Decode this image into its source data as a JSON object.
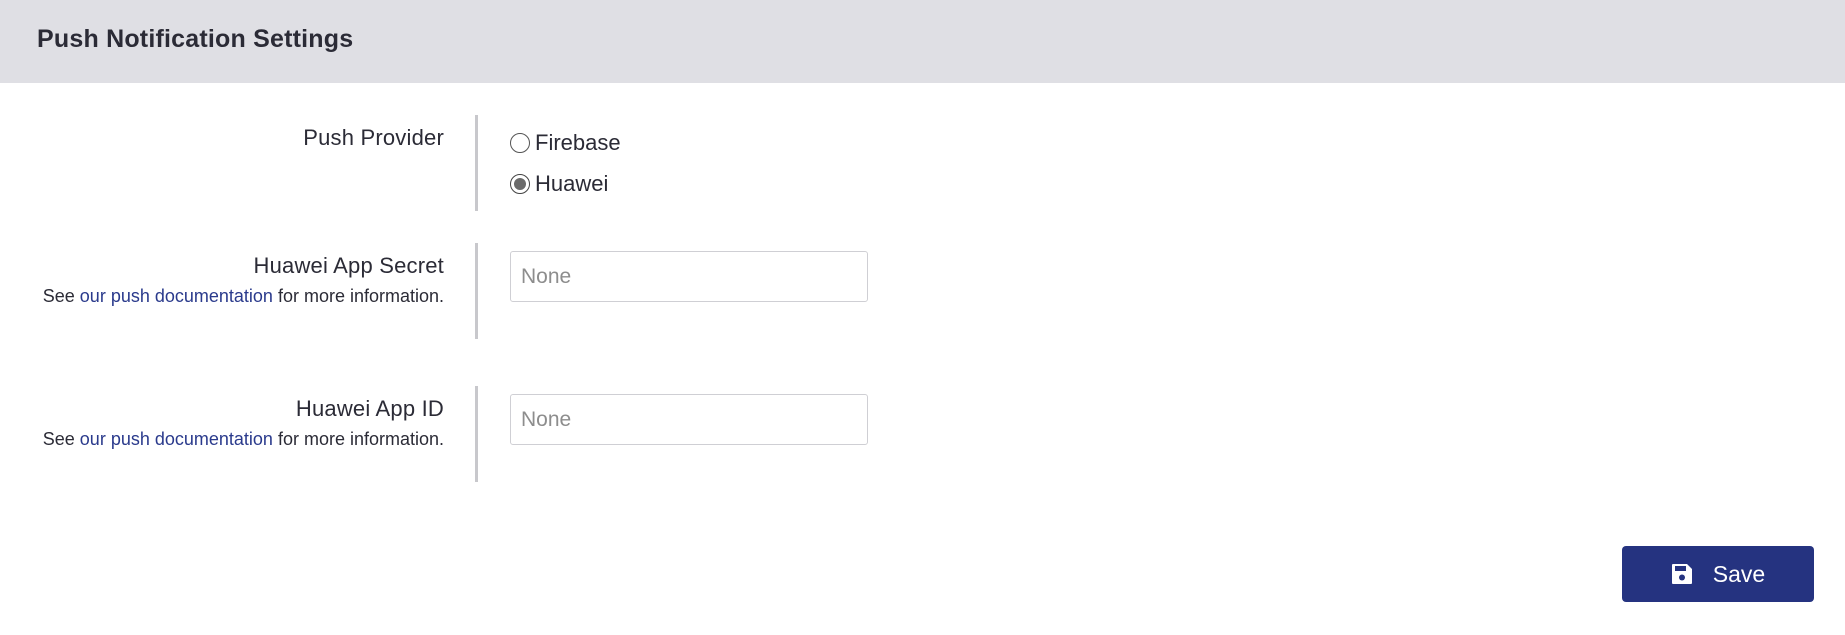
{
  "header": {
    "title": "Push Notification Settings"
  },
  "push_provider": {
    "label": "Push Provider",
    "options": [
      {
        "label": "Firebase",
        "selected": false
      },
      {
        "label": "Huawei",
        "selected": true
      }
    ]
  },
  "app_secret": {
    "label": "Huawei App Secret",
    "help_prefix": "See ",
    "help_link": "our push documentation",
    "help_suffix": " for more information.",
    "placeholder": "None",
    "value": ""
  },
  "app_id": {
    "label": "Huawei App ID",
    "help_prefix": "See ",
    "help_link": "our push documentation",
    "help_suffix": " for more information.",
    "placeholder": "None",
    "value": ""
  },
  "footer": {
    "save_label": "Save",
    "save_icon": "floppy-disk-icon"
  },
  "colors": {
    "primary": "#253380",
    "link": "#2a3a8c",
    "header_bg": "#dfdfe4"
  }
}
